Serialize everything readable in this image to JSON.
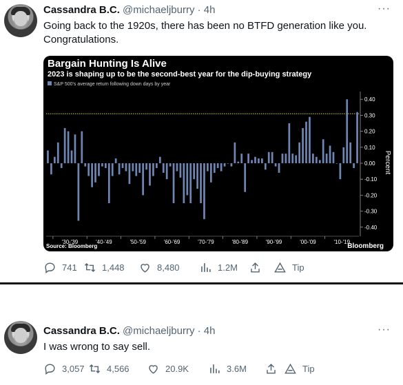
{
  "tweets": [
    {
      "author_name": "Cassandra B.C.",
      "handle": "@michaeljburry",
      "time": "· 4h",
      "text": "Going back to the 1920s, there has been no BTFD generation like you. Congratulations.",
      "stats": {
        "replies": "741",
        "retweets": "1,448",
        "likes": "8,480",
        "views": "1.2M",
        "tip": "Tip"
      }
    },
    {
      "author_name": "Cassandra B.C.",
      "handle": "@michaeljburry",
      "time": "· 4h",
      "text": "I was wrong to say sell.",
      "stats": {
        "replies": "3,057",
        "retweets": "4,566",
        "likes": "20.9K",
        "views": "3.6M",
        "tip": "Tip"
      }
    }
  ],
  "chart_data": {
    "type": "bar",
    "title": "Bargain Hunting Is Alive",
    "subtitle": "2023 is shaping up to be the second-best year for the dip-buying strategy",
    "legend": "S&P 500's average return following down days by year",
    "ylabel": "Percent",
    "source": "Source: Bloomberg",
    "brand": "Bloomberg",
    "ylim": [
      -0.45,
      0.45
    ],
    "yticks": [
      "0.40",
      "0.30",
      "0.20",
      "0.10",
      "0.00",
      "-0.10",
      "-0.20",
      "-0.30",
      "-0.40"
    ],
    "ytick_values": [
      0.4,
      0.3,
      0.2,
      0.1,
      0,
      -0.1,
      -0.2,
      -0.3,
      -0.4
    ],
    "decade_labels": [
      "'30-'39",
      "'40-'49",
      "'50-'59",
      "'60-'69",
      "'70-'79",
      "'80-'89",
      "'90-'99",
      "'00-'09",
      "'10-'19"
    ],
    "reference_line": 0.31,
    "bar_color": "#6f86b2",
    "ref_line_color": "#e5d44a",
    "years": [
      1928,
      1929,
      1930,
      1931,
      1932,
      1933,
      1934,
      1935,
      1936,
      1937,
      1938,
      1939,
      1940,
      1941,
      1942,
      1943,
      1944,
      1945,
      1946,
      1947,
      1948,
      1949,
      1950,
      1951,
      1952,
      1953,
      1954,
      1955,
      1956,
      1957,
      1958,
      1959,
      1960,
      1961,
      1962,
      1963,
      1964,
      1965,
      1966,
      1967,
      1968,
      1969,
      1970,
      1971,
      1972,
      1973,
      1974,
      1975,
      1976,
      1977,
      1978,
      1979,
      1980,
      1981,
      1982,
      1983,
      1984,
      1985,
      1986,
      1987,
      1988,
      1989,
      1990,
      1991,
      1992,
      1993,
      1994,
      1995,
      1996,
      1997,
      1998,
      1999,
      2000,
      2001,
      2002,
      2003,
      2004,
      2005,
      2006,
      2007,
      2008,
      2009,
      2010,
      2011,
      2012,
      2013,
      2014,
      2015,
      2016,
      2017,
      2018,
      2019,
      2020,
      2021,
      2022,
      2023
    ],
    "values": [
      0.08,
      -0.07,
      0.04,
      0.13,
      -0.03,
      0.22,
      0.2,
      0.08,
      0.18,
      -0.36,
      0.2,
      -0.02,
      -0.08,
      -0.15,
      -0.12,
      -0.08,
      -0.02,
      -0.03,
      -0.25,
      -0.08,
      0.03,
      -0.07,
      -0.03,
      -0.05,
      -0.13,
      -0.05,
      -0.08,
      -0.06,
      -0.2,
      -0.04,
      -0.14,
      -0.08,
      -0.03,
      0.04,
      -0.06,
      -0.1,
      -0.02,
      -0.25,
      -0.05,
      -0.09,
      -0.25,
      -0.2,
      -0.25,
      -0.1,
      -0.16,
      -0.25,
      -0.35,
      -0.05,
      -0.12,
      -0.06,
      -0.03,
      -0.05,
      -0.02,
      0.0,
      -0.02,
      0.13,
      0.01,
      0.06,
      -0.18,
      0.06,
      0.02,
      0.04,
      0.03,
      0.03,
      -0.04,
      0.07,
      0.07,
      -0.02,
      -0.06,
      0.06,
      0.06,
      0.25,
      0.06,
      0.05,
      0.13,
      0.22,
      0.26,
      0.29,
      0.06,
      0.04,
      0.02,
      0.15,
      0.06,
      0.11,
      0.07,
      0.0,
      -0.1,
      0.1,
      0.4,
      0.13,
      -0.03,
      0.32
    ]
  }
}
